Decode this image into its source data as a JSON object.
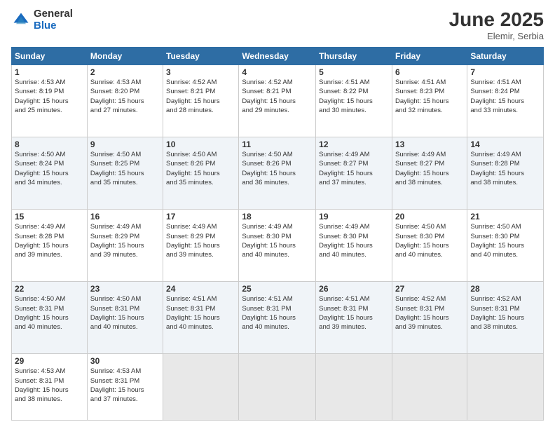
{
  "header": {
    "logo_general": "General",
    "logo_blue": "Blue",
    "month": "June 2025",
    "location": "Elemir, Serbia"
  },
  "days_of_week": [
    "Sunday",
    "Monday",
    "Tuesday",
    "Wednesday",
    "Thursday",
    "Friday",
    "Saturday"
  ],
  "weeks": [
    [
      {
        "day": "1",
        "info": "Sunrise: 4:53 AM\nSunset: 8:19 PM\nDaylight: 15 hours\nand 25 minutes."
      },
      {
        "day": "2",
        "info": "Sunrise: 4:53 AM\nSunset: 8:20 PM\nDaylight: 15 hours\nand 27 minutes."
      },
      {
        "day": "3",
        "info": "Sunrise: 4:52 AM\nSunset: 8:21 PM\nDaylight: 15 hours\nand 28 minutes."
      },
      {
        "day": "4",
        "info": "Sunrise: 4:52 AM\nSunset: 8:21 PM\nDaylight: 15 hours\nand 29 minutes."
      },
      {
        "day": "5",
        "info": "Sunrise: 4:51 AM\nSunset: 8:22 PM\nDaylight: 15 hours\nand 30 minutes."
      },
      {
        "day": "6",
        "info": "Sunrise: 4:51 AM\nSunset: 8:23 PM\nDaylight: 15 hours\nand 32 minutes."
      },
      {
        "day": "7",
        "info": "Sunrise: 4:51 AM\nSunset: 8:24 PM\nDaylight: 15 hours\nand 33 minutes."
      }
    ],
    [
      {
        "day": "8",
        "info": "Sunrise: 4:50 AM\nSunset: 8:24 PM\nDaylight: 15 hours\nand 34 minutes."
      },
      {
        "day": "9",
        "info": "Sunrise: 4:50 AM\nSunset: 8:25 PM\nDaylight: 15 hours\nand 35 minutes."
      },
      {
        "day": "10",
        "info": "Sunrise: 4:50 AM\nSunset: 8:26 PM\nDaylight: 15 hours\nand 35 minutes."
      },
      {
        "day": "11",
        "info": "Sunrise: 4:50 AM\nSunset: 8:26 PM\nDaylight: 15 hours\nand 36 minutes."
      },
      {
        "day": "12",
        "info": "Sunrise: 4:49 AM\nSunset: 8:27 PM\nDaylight: 15 hours\nand 37 minutes."
      },
      {
        "day": "13",
        "info": "Sunrise: 4:49 AM\nSunset: 8:27 PM\nDaylight: 15 hours\nand 38 minutes."
      },
      {
        "day": "14",
        "info": "Sunrise: 4:49 AM\nSunset: 8:28 PM\nDaylight: 15 hours\nand 38 minutes."
      }
    ],
    [
      {
        "day": "15",
        "info": "Sunrise: 4:49 AM\nSunset: 8:28 PM\nDaylight: 15 hours\nand 39 minutes."
      },
      {
        "day": "16",
        "info": "Sunrise: 4:49 AM\nSunset: 8:29 PM\nDaylight: 15 hours\nand 39 minutes."
      },
      {
        "day": "17",
        "info": "Sunrise: 4:49 AM\nSunset: 8:29 PM\nDaylight: 15 hours\nand 39 minutes."
      },
      {
        "day": "18",
        "info": "Sunrise: 4:49 AM\nSunset: 8:30 PM\nDaylight: 15 hours\nand 40 minutes."
      },
      {
        "day": "19",
        "info": "Sunrise: 4:49 AM\nSunset: 8:30 PM\nDaylight: 15 hours\nand 40 minutes."
      },
      {
        "day": "20",
        "info": "Sunrise: 4:50 AM\nSunset: 8:30 PM\nDaylight: 15 hours\nand 40 minutes."
      },
      {
        "day": "21",
        "info": "Sunrise: 4:50 AM\nSunset: 8:30 PM\nDaylight: 15 hours\nand 40 minutes."
      }
    ],
    [
      {
        "day": "22",
        "info": "Sunrise: 4:50 AM\nSunset: 8:31 PM\nDaylight: 15 hours\nand 40 minutes."
      },
      {
        "day": "23",
        "info": "Sunrise: 4:50 AM\nSunset: 8:31 PM\nDaylight: 15 hours\nand 40 minutes."
      },
      {
        "day": "24",
        "info": "Sunrise: 4:51 AM\nSunset: 8:31 PM\nDaylight: 15 hours\nand 40 minutes."
      },
      {
        "day": "25",
        "info": "Sunrise: 4:51 AM\nSunset: 8:31 PM\nDaylight: 15 hours\nand 40 minutes."
      },
      {
        "day": "26",
        "info": "Sunrise: 4:51 AM\nSunset: 8:31 PM\nDaylight: 15 hours\nand 39 minutes."
      },
      {
        "day": "27",
        "info": "Sunrise: 4:52 AM\nSunset: 8:31 PM\nDaylight: 15 hours\nand 39 minutes."
      },
      {
        "day": "28",
        "info": "Sunrise: 4:52 AM\nSunset: 8:31 PM\nDaylight: 15 hours\nand 38 minutes."
      }
    ],
    [
      {
        "day": "29",
        "info": "Sunrise: 4:53 AM\nSunset: 8:31 PM\nDaylight: 15 hours\nand 38 minutes."
      },
      {
        "day": "30",
        "info": "Sunrise: 4:53 AM\nSunset: 8:31 PM\nDaylight: 15 hours\nand 37 minutes."
      },
      null,
      null,
      null,
      null,
      null
    ]
  ]
}
